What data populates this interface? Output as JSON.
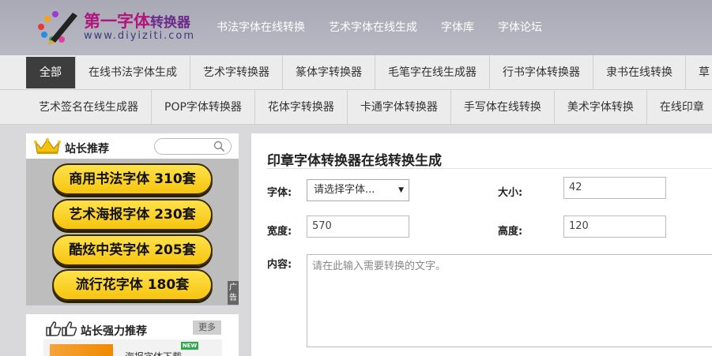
{
  "header": {
    "logo_title": "第一字体",
    "logo_sub": "转换器",
    "logo_url": "www.diyiziti.com",
    "nav": [
      "书法字体在线转换",
      "艺术字体在线生成",
      "字体库",
      "字体论坛"
    ]
  },
  "categories_row1": [
    "全部",
    "在线书法字体生成",
    "艺术字转换器",
    "篆体字转换器",
    "毛笔字在线生成器",
    "行书字体转换器",
    "隶书在线转换",
    "草"
  ],
  "categories_row2": [
    "艺术签名在线生成器",
    "POP字体转换器",
    "花体字转换器",
    "卡通字体转换器",
    "手写体在线转换",
    "美术字体转换",
    "在线印章"
  ],
  "sidebar": {
    "recommend_title": "站长推荐",
    "ads": [
      "商用书法字体  310套",
      "艺术海报字体  230套",
      "酷炫中英字体  205套",
      "流行花字体    180套"
    ],
    "ad_tag": "广告",
    "strong_title": "站长强力推荐",
    "more_label": "更多",
    "new_badge": "NEW",
    "strong_item": "海报字体下载"
  },
  "main": {
    "title": "印章字体转换器在线转换生成",
    "font_label": "字体:",
    "font_select": "请选择字体...",
    "size_label": "大小:",
    "size_value": "42",
    "width_label": "宽度:",
    "width_value": "570",
    "height_label": "高度:",
    "height_value": "120",
    "content_label": "内容:",
    "content_placeholder": "请在此输入需要转换的文字。"
  },
  "colors": {
    "header_bg": "#b3b3bf",
    "logo_title": "#b0157c",
    "active_tab": "#3d3d3d",
    "ad_button": "#f7c40f"
  }
}
